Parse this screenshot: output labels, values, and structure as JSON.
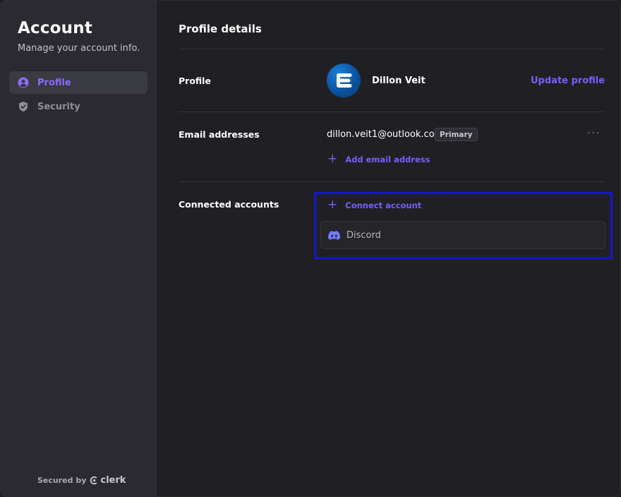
{
  "sidebar": {
    "title": "Account",
    "subtitle": "Manage your account info.",
    "items": [
      {
        "label": "Profile",
        "icon": "user-circle-icon",
        "active": true
      },
      {
        "label": "Security",
        "icon": "shield-icon",
        "active": false
      }
    ],
    "footer": {
      "secured_by": "Secured by",
      "brand": "clerk"
    }
  },
  "main": {
    "title": "Profile details",
    "profile": {
      "label": "Profile",
      "name": "Dillon Veit",
      "update_link": "Update profile"
    },
    "emails": {
      "label": "Email addresses",
      "address": "dillon.veit1@outlook.com",
      "badge": "Primary",
      "more": "···",
      "add_link": "Add email address"
    },
    "connected": {
      "label": "Connected accounts",
      "connect_link": "Connect account",
      "providers": [
        {
          "label": "Discord",
          "icon": "discord-icon"
        }
      ]
    }
  },
  "colors": {
    "accent": "#7b5cff",
    "background": "#202024",
    "sidebar": "#2a2a30",
    "highlight_border": "#1414d8"
  }
}
